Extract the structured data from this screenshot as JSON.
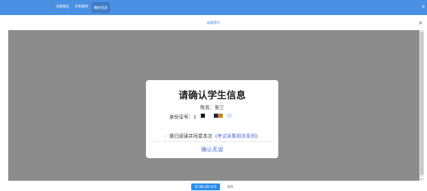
{
  "topbar": {
    "tabs": [
      "注册报名",
      "手机绑定",
      "确定信息"
    ],
    "active_tab": 2
  },
  "dialog": {
    "title": "采集照片",
    "close_glyph": "×"
  },
  "modal": {
    "heading": "请确认学生信息",
    "name_label": "姓名：",
    "name_value": "张三",
    "id_label": "身份证号：",
    "id_prefix": "1",
    "agree_check": "✓",
    "agree_text": "我已阅读并同意本次",
    "agree_link": "《考试采集相关条例》",
    "confirm_label": "确认无误"
  },
  "footer": {
    "primary_label": "我已确认照片信息",
    "cancel_label": "取消"
  },
  "colors": {
    "topbar": "#4a90e2",
    "overlay": "#8c8c8c",
    "link": "#4a6fd8",
    "primary_button": "#2a8cf0"
  }
}
